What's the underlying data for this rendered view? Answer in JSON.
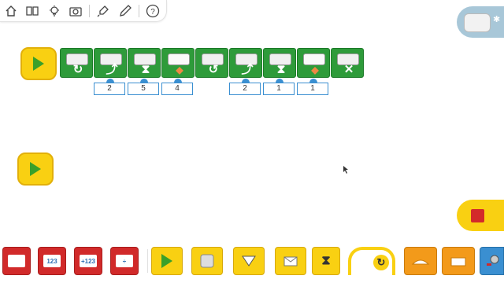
{
  "toolbar": {
    "items": [
      "home-icon",
      "book-icon",
      "lightbulb-icon",
      "camera-icon",
      "microphone-icon",
      "pencil-icon",
      "help-icon"
    ],
    "help_glyph": "?"
  },
  "hub": {
    "status": "connected",
    "icon": "bluetooth-icon",
    "bt_glyph": "✱"
  },
  "program": {
    "blocks": [
      {
        "type": "motor-this-way",
        "glyph": "↻"
      },
      {
        "type": "motor-power",
        "glyph": "⤴"
      },
      {
        "type": "motor-on-for",
        "glyph": "⧗"
      },
      {
        "type": "light",
        "glyph": "◆"
      },
      {
        "type": "motor-that-way",
        "glyph": "↺"
      },
      {
        "type": "motor-power",
        "glyph": "⤴"
      },
      {
        "type": "motor-on-for",
        "glyph": "⧗"
      },
      {
        "type": "light",
        "glyph": "◆"
      },
      {
        "type": "motor-off",
        "glyph": "✕"
      }
    ],
    "params": [
      "2",
      "5",
      "4",
      "2",
      "1",
      "1"
    ]
  },
  "palette": {
    "items": [
      {
        "name": "display-background-block",
        "label": ""
      },
      {
        "name": "display-number-block",
        "label": "123"
      },
      {
        "name": "add-to-display-block",
        "label": "+123"
      },
      {
        "name": "divide-display-block",
        "label": "÷"
      },
      {
        "name": "start-block",
        "label": ""
      },
      {
        "name": "key-press-start-block",
        "label": ""
      },
      {
        "name": "tilt-block",
        "label": ""
      },
      {
        "name": "message-block",
        "label": ""
      },
      {
        "name": "wait-block",
        "label": "⧗"
      },
      {
        "name": "loop-block",
        "label": ""
      },
      {
        "name": "repeat-block",
        "label": "↻"
      },
      {
        "name": "action-block-1",
        "label": ""
      },
      {
        "name": "action-block-2",
        "label": ""
      },
      {
        "name": "sound-block",
        "label": ""
      }
    ]
  },
  "colors": {
    "green": "#2e9b3a",
    "yellow": "#f9d012",
    "red": "#d12a2a",
    "blue": "#3a8fd1",
    "orange": "#f39a1a",
    "hub": "#a8c7d8"
  }
}
